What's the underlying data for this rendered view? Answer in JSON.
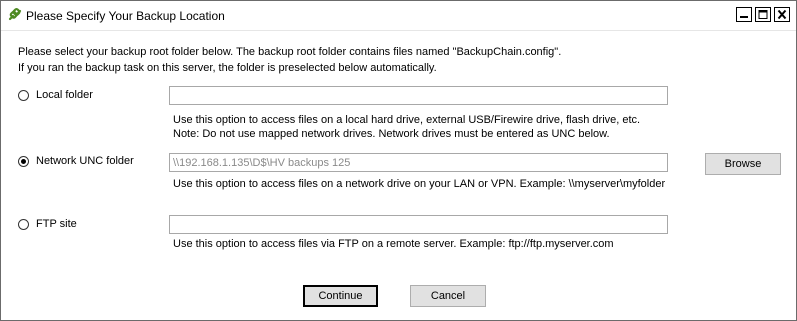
{
  "window": {
    "title": "Please Specify Your Backup Location",
    "icon": "chain-link-icon",
    "controls": {
      "minimize": "minimize-icon",
      "maximize": "maximize-icon",
      "close": "close-icon"
    }
  },
  "intro": {
    "line1": "Please select your backup root folder below. The backup root folder contains files named \"BackupChain.config\".",
    "line2": "If you ran the backup task on this server, the folder is preselected below automatically."
  },
  "options": {
    "local": {
      "label": "Local folder",
      "selected": false,
      "value": "",
      "help1": "Use this option to access files on a local hard drive, external USB/Firewire drive, flash drive, etc.",
      "help2": "Note: Do not use mapped network drives. Network drives must be entered as UNC below."
    },
    "unc": {
      "label": "Network UNC folder",
      "selected": true,
      "value": "\\\\192.168.1.135\\D$\\HV backups 125",
      "browse_label": "Browse",
      "help1": "Use this option to access files on a network drive on your LAN or VPN. Example: \\\\myserver\\myfolder"
    },
    "ftp": {
      "label": "FTP site",
      "selected": false,
      "value": "",
      "help1": "Use this option to access files via FTP on a remote server. Example: ftp://ftp.myserver.com"
    }
  },
  "buttons": {
    "continue": "Continue",
    "cancel": "Cancel"
  },
  "colors": {
    "border": "#6b6b6b",
    "button_bg": "#e1e1e1",
    "disabled_text": "#8a8a8a",
    "icon_green": "#5a9a2a"
  }
}
